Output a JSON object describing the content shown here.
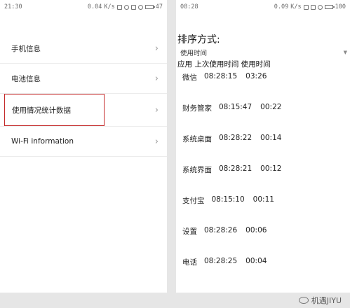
{
  "left": {
    "status": {
      "time": "21:30",
      "speed": "0.04",
      "speed_unit": "K/s",
      "battery": "47"
    },
    "menu": [
      {
        "label": "手机信息"
      },
      {
        "label": "电池信息"
      },
      {
        "label": "使用情况统计数据"
      },
      {
        "label": "Wi-Fi information"
      }
    ],
    "chevron": "›"
  },
  "right": {
    "status": {
      "time": "08:28",
      "speed": "0.09",
      "speed_unit": "K/s",
      "battery": "100"
    },
    "sort_title": "排序方式:",
    "sort_value": "使用时间",
    "header": "应用  上次使用时间  使用时间",
    "apps": [
      {
        "name": "微信",
        "last": "08:28:15",
        "duration": "03:26"
      },
      {
        "name": "财务管家",
        "last": "08:15:47",
        "duration": "00:22"
      },
      {
        "name": "系统桌面",
        "last": "08:28:22",
        "duration": "00:14"
      },
      {
        "name": "系统界面",
        "last": "08:28:21",
        "duration": "00:12"
      },
      {
        "name": "支付宝",
        "last": "08:15:10",
        "duration": "00:11"
      },
      {
        "name": "设置",
        "last": "08:28:26",
        "duration": "00:06"
      },
      {
        "name": "电话",
        "last": "08:28:25",
        "duration": "00:04"
      }
    ]
  },
  "watermark": "机遇JIYU",
  "highlight_color": "#c42a2a"
}
